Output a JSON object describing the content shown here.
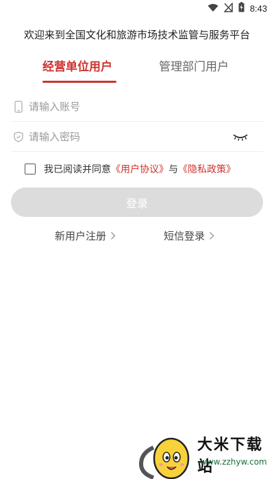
{
  "status_bar": {
    "time": "8:43",
    "icons": [
      "wifi-icon",
      "signal-off-icon",
      "battery-charging-icon"
    ]
  },
  "header": {
    "welcome": "欢迎来到全国文化和旅游市场技术监管与服务平台"
  },
  "tabs": [
    {
      "label": "经营单位用户",
      "active": true
    },
    {
      "label": "管理部门用户",
      "active": false
    }
  ],
  "form": {
    "account_placeholder": "请输入账号",
    "account_value": "",
    "password_placeholder": "请输入密码",
    "password_value": ""
  },
  "agreement": {
    "prefix": "我已阅读并同意",
    "user_agreement": "《用户协议》",
    "joiner": "与",
    "privacy_policy": "《隐私政策》",
    "checked": false
  },
  "login_button": {
    "label": "登录"
  },
  "links": {
    "register": "新用户注册",
    "sms_login": "短信登录"
  },
  "watermark": {
    "title": "大米下载站",
    "url": "www.zzhyw.com"
  },
  "colors": {
    "accent": "#d0312d",
    "button_disabled": "#dcdcdc"
  }
}
